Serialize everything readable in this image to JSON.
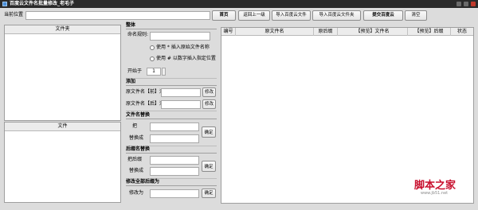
{
  "window": {
    "title": "百度云文件名批量修改_老毛子"
  },
  "toolbar": {
    "location_label": "当前位置",
    "buttons": {
      "home": "首页",
      "back": "返回上一级",
      "import_file": "导入百度云文件",
      "import_folder": "导入百度云文件夹",
      "submit": "提交百度云",
      "clear": "清空"
    }
  },
  "left": {
    "folder_header": "文件夹",
    "file_header": "文件"
  },
  "options": {
    "overall": {
      "title": "整体",
      "naming_rule_label": "命名规则:",
      "hint1": "使用 * 插入原始文件名称",
      "hint2": "使用 # 以数字插入指定位置",
      "start_label": "开始于",
      "start_value": "1"
    },
    "add": {
      "title": "添加",
      "front_label": "原文件名【前】添加",
      "front_button": "修改",
      "back_label": "原文件名【后】添加",
      "back_button": "修改"
    },
    "replace_name": {
      "title": "文件名替换",
      "find_label": "把",
      "replace_label": "替换成",
      "confirm": "确定"
    },
    "replace_ext": {
      "title": "后缀名替换",
      "find_label": "把后缀",
      "replace_label": "替换成",
      "confirm": "确定"
    },
    "change_ext": {
      "title": "修改全部后缀为",
      "label": "修改为",
      "confirm": "确定"
    }
  },
  "table": {
    "columns": [
      "编号",
      "原文件名",
      "原后缀",
      "【预览】文件名",
      "【预览】后缀",
      "状态"
    ]
  },
  "watermark": {
    "text": "脚本之家",
    "url": "www.jb51.net"
  }
}
